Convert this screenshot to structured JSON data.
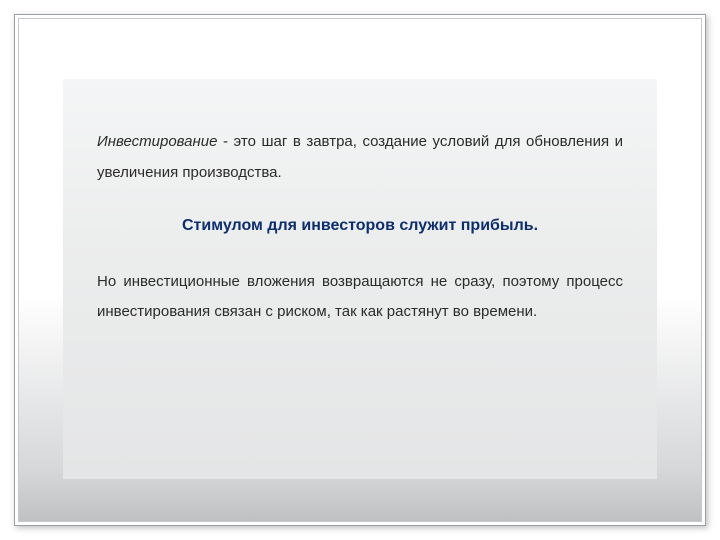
{
  "card": {
    "para1_lead": "Инвестирование",
    "para1_rest": " - это шаг в завтра, создание условий для обновления и увеличения производства.",
    "headline": "Стимулом для инвесторов служит прибыль.",
    "para2": "Но инвестиционные вложения возвращаются не сразу, поэтому процесс инвестирования связан с риском, так как растянут во времени."
  }
}
